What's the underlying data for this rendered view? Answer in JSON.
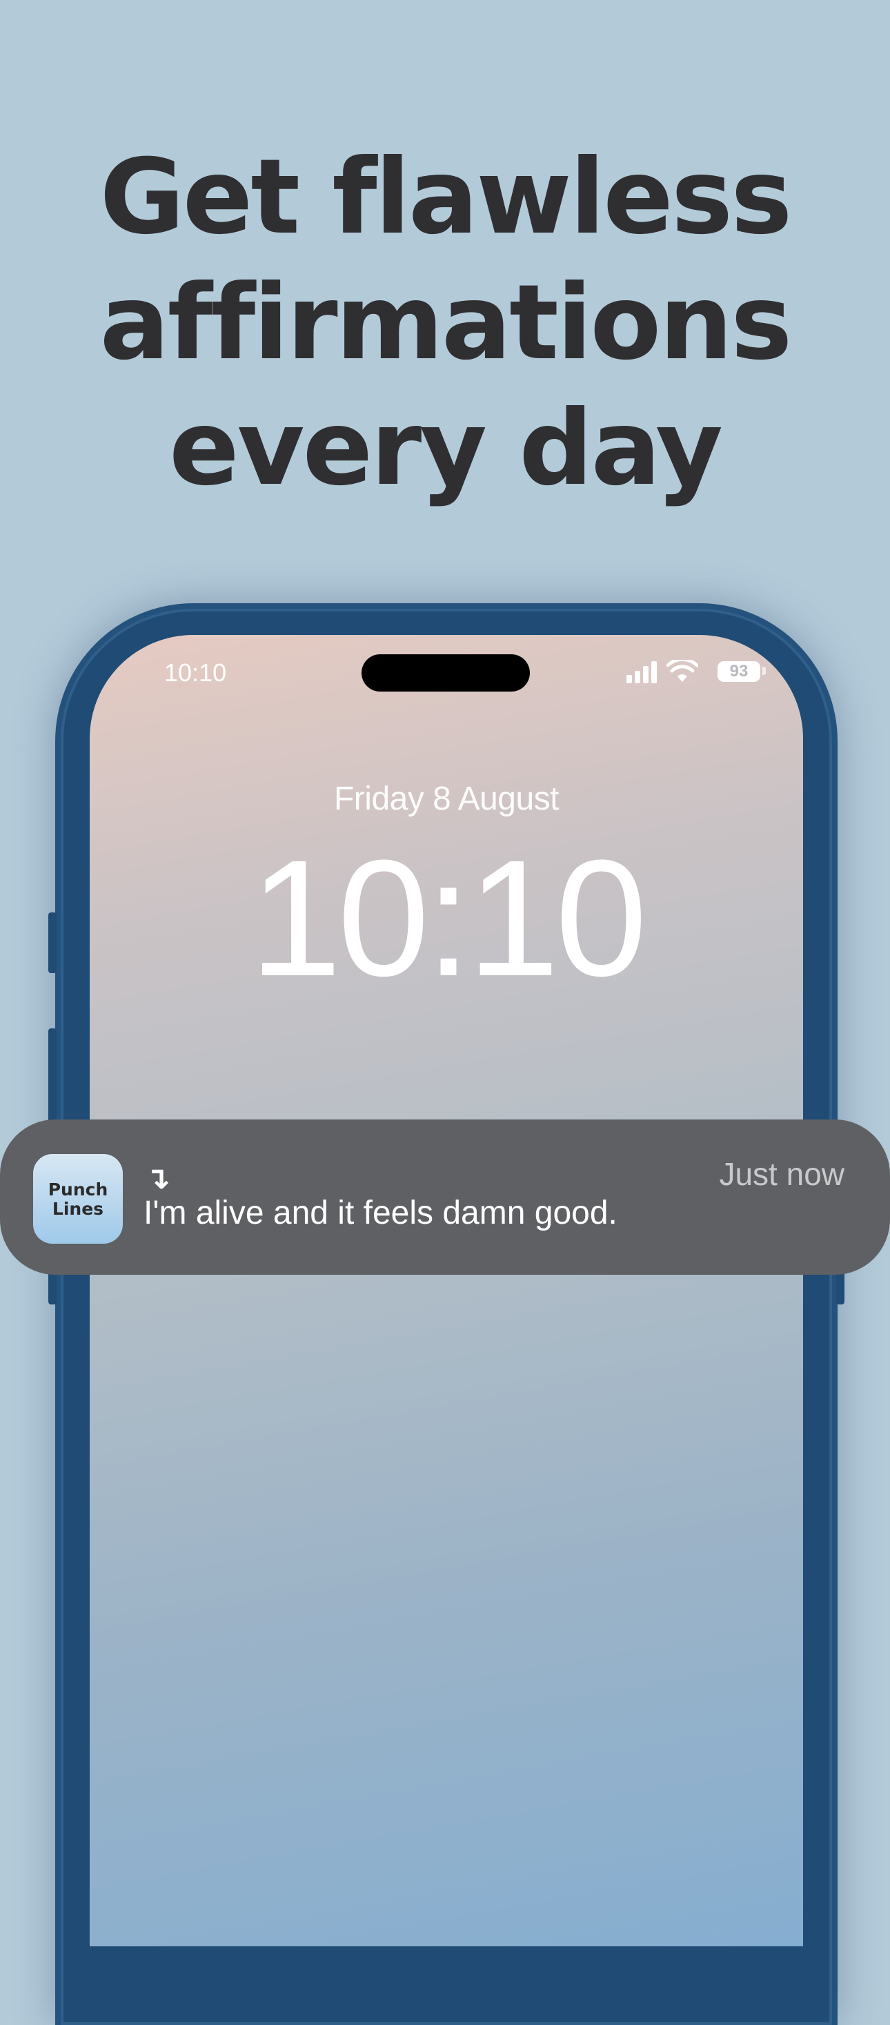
{
  "headline": {
    "line1": "Get flawless",
    "line2": "affirmations",
    "line3": "every day"
  },
  "lockscreen": {
    "status_time": "10:10",
    "battery_level": "93",
    "date": "Friday 8 August",
    "clock": "10:10"
  },
  "notification": {
    "app_icon_line1": "Punch",
    "app_icon_line2": "Lines",
    "arrow_glyph": "↴",
    "time": "Just now",
    "message": "I'm alive and it feels damn good."
  },
  "colors": {
    "background": "#b3cad9",
    "phone_frame": "#24527c",
    "notification_bg": "#5f6063",
    "headline_text": "#2f2f31"
  }
}
